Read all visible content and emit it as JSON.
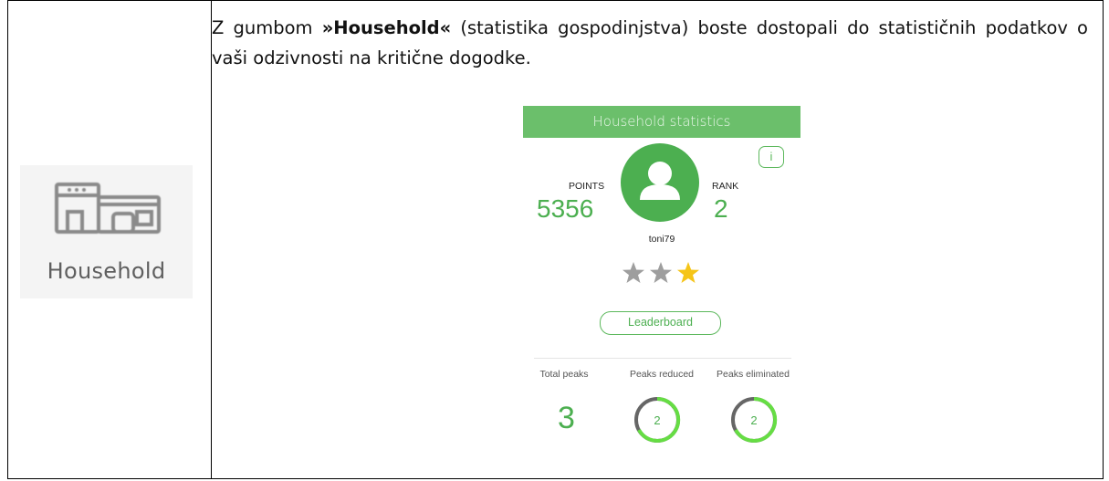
{
  "left_cell": {
    "icon": "household-icon",
    "label": "Household"
  },
  "description": {
    "prefix": "Z gumbom ",
    "bold": "»Household«",
    "suffix": " (statistika gospodinjstva) boste dostopali do statističnih podatkov o vaši odzivnosti na kritične dogodke."
  },
  "app": {
    "header_title": "Household statistics",
    "info_label": "i",
    "points_label": "POINTS",
    "points_value": "5356",
    "rank_label": "RANK",
    "rank_value": "2",
    "avatar_icon": "user-icon",
    "username": "toni79",
    "stars": {
      "filled": 1,
      "total": 3
    },
    "leaderboard_label": "Leaderboard",
    "stats": {
      "total_label": "Total peaks",
      "total_value": "3",
      "reduced_label": "Peaks reduced",
      "reduced_value": "2",
      "eliminated_label": "Peaks eliminated",
      "eliminated_value": "2"
    },
    "colors": {
      "accent": "#4caf50",
      "header": "#6bbf6b",
      "star_active": "#f5c518",
      "star_inactive": "#9e9e9e",
      "ring_bright": "#66dd44",
      "ring_dark": "#666666"
    }
  }
}
